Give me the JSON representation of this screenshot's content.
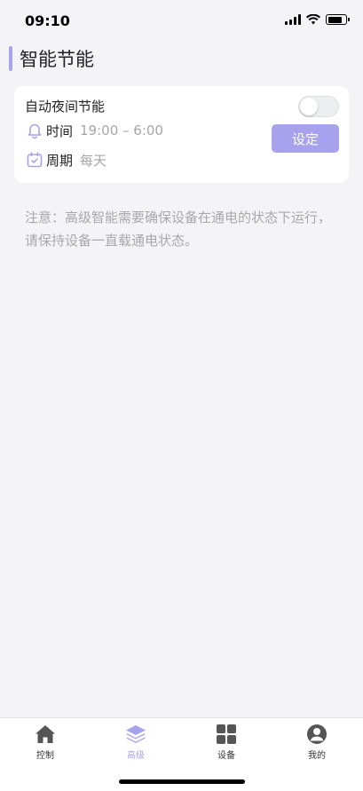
{
  "status_bar": {
    "time": "09:10"
  },
  "header": {
    "title": "智能节能"
  },
  "card": {
    "title": "自动夜间节能",
    "toggle_on": false,
    "time_label": "时间",
    "time_value": "19:00 – 6:00",
    "cycle_label": "周期",
    "cycle_value": "每天",
    "set_button": "设定"
  },
  "notice": "注意：高级智能需要确保设备在通电的状态下运行，请保持设备一直载通电状态。",
  "tabs": [
    {
      "label": "控制",
      "icon": "home-icon",
      "active": false
    },
    {
      "label": "高级",
      "icon": "layers-icon",
      "active": true
    },
    {
      "label": "设备",
      "icon": "grid-icon",
      "active": false
    },
    {
      "label": "我的",
      "icon": "user-icon",
      "active": false
    }
  ],
  "colors": {
    "accent": "#a8a2ec",
    "inactive_icon": "#555555",
    "muted_text": "#a8a8a8"
  }
}
